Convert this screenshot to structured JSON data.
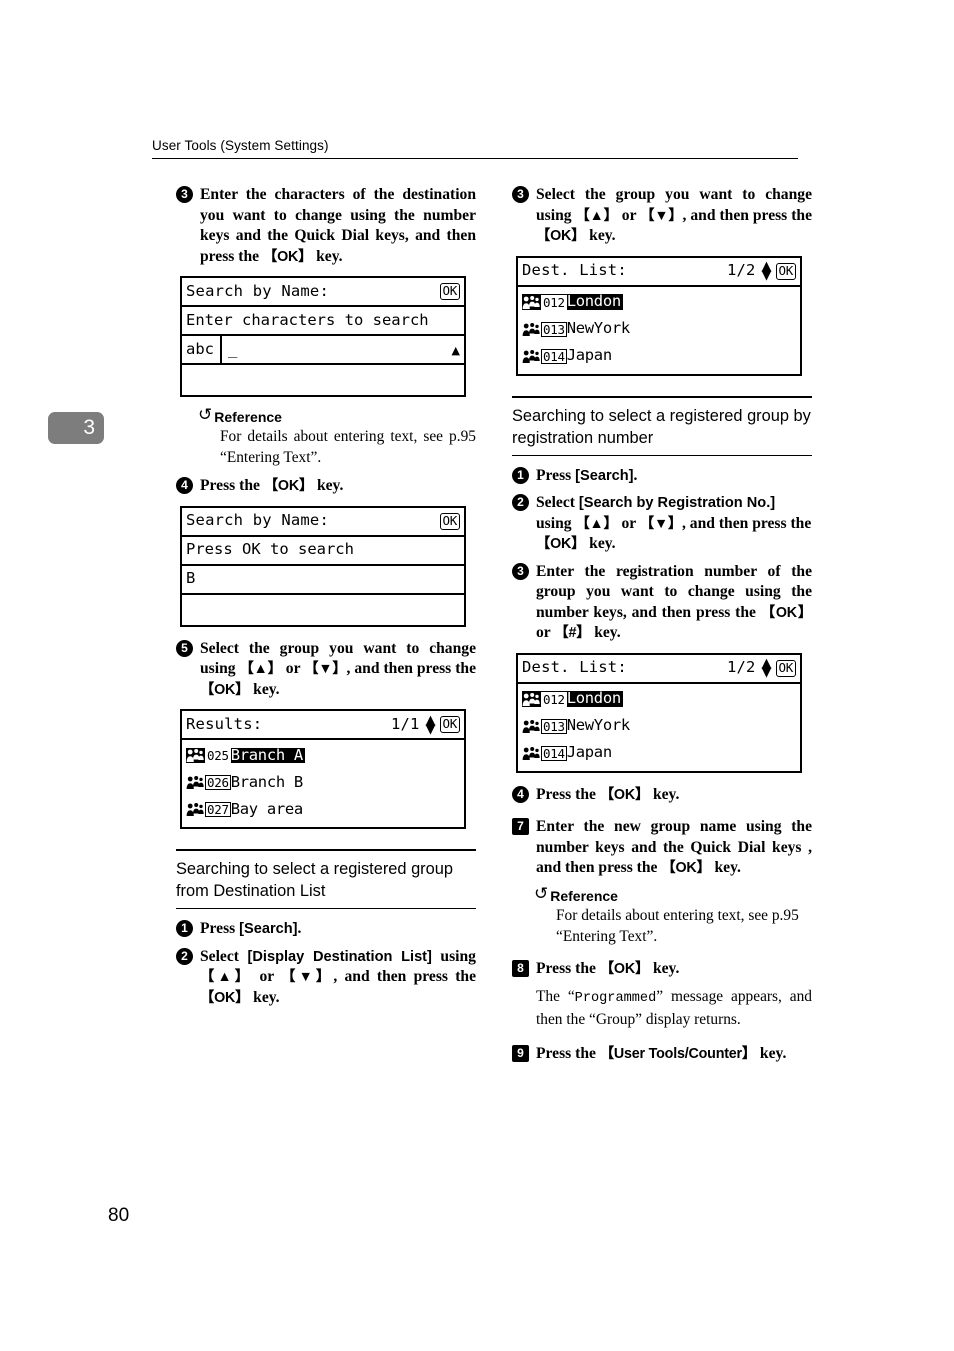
{
  "header": {
    "running_head": "User Tools (System Settings)"
  },
  "chapter_tab": {
    "number": "3"
  },
  "folio": {
    "page_number": "80"
  },
  "left_column": {
    "step3": {
      "marker": "3",
      "text_parts": [
        "Enter the characters of the destination you want to change using the number keys and the Quick Dial keys, and then press the ",
        "【OK】",
        " key."
      ]
    },
    "lcd_search_by_name_empty": {
      "title": "Search by Name:",
      "ok_label": "OK",
      "prompt": "Enter characters to search",
      "mode_label": "abc",
      "input_value": "_",
      "scroll_indicator": "▲"
    },
    "reference": {
      "heading": "Reference",
      "body": "For details about entering text, see p.95 “Entering Text”."
    },
    "step4": {
      "marker": "4",
      "text_parts": [
        "Press the ",
        "【OK】",
        " key."
      ]
    },
    "lcd_search_by_name_filled": {
      "title": "Search by Name:",
      "ok_label": "OK",
      "prompt": "Press OK to search",
      "input_value": "B"
    },
    "step5": {
      "marker": "5",
      "text_parts": [
        "Select the group you want to change using ",
        "【▲】",
        " or ",
        "【▼】",
        ", and then press the ",
        "【OK】",
        " key."
      ]
    },
    "lcd_results": {
      "title": "Results:",
      "page_counter": "1/1",
      "ok_label": "OK",
      "items": [
        {
          "reg_no": "025",
          "name": "Branch A",
          "selected": true
        },
        {
          "reg_no": "026",
          "name": "Branch B",
          "selected": false
        },
        {
          "reg_no": "027",
          "name": "Bay area",
          "selected": false
        }
      ]
    },
    "section_dest_list": {
      "heading": "Searching to select a registered group from Destination List",
      "step1": {
        "marker": "1",
        "text_parts": [
          "Press ",
          "[Search]",
          "."
        ]
      },
      "step2": {
        "marker": "2",
        "text_parts": [
          "Select ",
          "[Display Destination List]",
          " using ",
          "【▲】",
          " or ",
          "【▼】",
          ", and then press the ",
          "【OK】",
          " key."
        ]
      }
    }
  },
  "right_column": {
    "step3": {
      "marker": "3",
      "text_parts": [
        "Select the group you want to change using ",
        "【▲】",
        " or ",
        "【▼】",
        ", and then press the ",
        "【OK】",
        " key."
      ]
    },
    "lcd_dest_list_top": {
      "title": "Dest. List:",
      "page_counter": "1/2",
      "ok_label": "OK",
      "items": [
        {
          "reg_no": "012",
          "name": "London",
          "selected": true
        },
        {
          "reg_no": "013",
          "name": "NewYork",
          "selected": false
        },
        {
          "reg_no": "014",
          "name": "Japan",
          "selected": false
        }
      ]
    },
    "section_reg_no": {
      "heading": "Searching to select a registered group by registration number",
      "step1": {
        "marker": "1",
        "text_parts": [
          "Press ",
          "[Search]",
          "."
        ]
      },
      "step2": {
        "marker": "2",
        "text_parts": [
          "Select ",
          "[Search by Registration No.]",
          " using ",
          "【▲】",
          " or ",
          "【▼】",
          ", and then press the ",
          "【OK】",
          " key."
        ]
      },
      "step3": {
        "marker": "3",
        "text_parts": [
          "Enter the registration number of the group you want to change using the number keys, and then press the ",
          "【OK】",
          " or ",
          "【#】",
          " key."
        ]
      }
    },
    "lcd_dest_list_bottom": {
      "title": "Dest. List:",
      "page_counter": "1/2",
      "ok_label": "OK",
      "items": [
        {
          "reg_no": "012",
          "name": "London",
          "selected": true
        },
        {
          "reg_no": "013",
          "name": "NewYork",
          "selected": false
        },
        {
          "reg_no": "014",
          "name": "Japan",
          "selected": false
        }
      ]
    },
    "step4": {
      "marker": "4",
      "text_parts": [
        "Press the ",
        "【OK】",
        " key."
      ]
    },
    "step7": {
      "marker": "7",
      "text_parts": [
        "Enter the new group name using the number keys and the Quick Dial keys , and then press the ",
        "【OK】",
        " key."
      ]
    },
    "reference": {
      "heading": "Reference",
      "body": "For details about entering text, see p.95 “Entering Text”."
    },
    "step8": {
      "marker": "8",
      "text_parts": [
        "Press the ",
        "【OK】",
        " key."
      ],
      "body_parts": [
        "The “",
        "Programmed",
        "” message appears, and then the “Group” display returns."
      ]
    },
    "step9": {
      "marker": "9",
      "text_parts": [
        "Press the ",
        "【User Tools/Counter】",
        " key."
      ]
    }
  }
}
